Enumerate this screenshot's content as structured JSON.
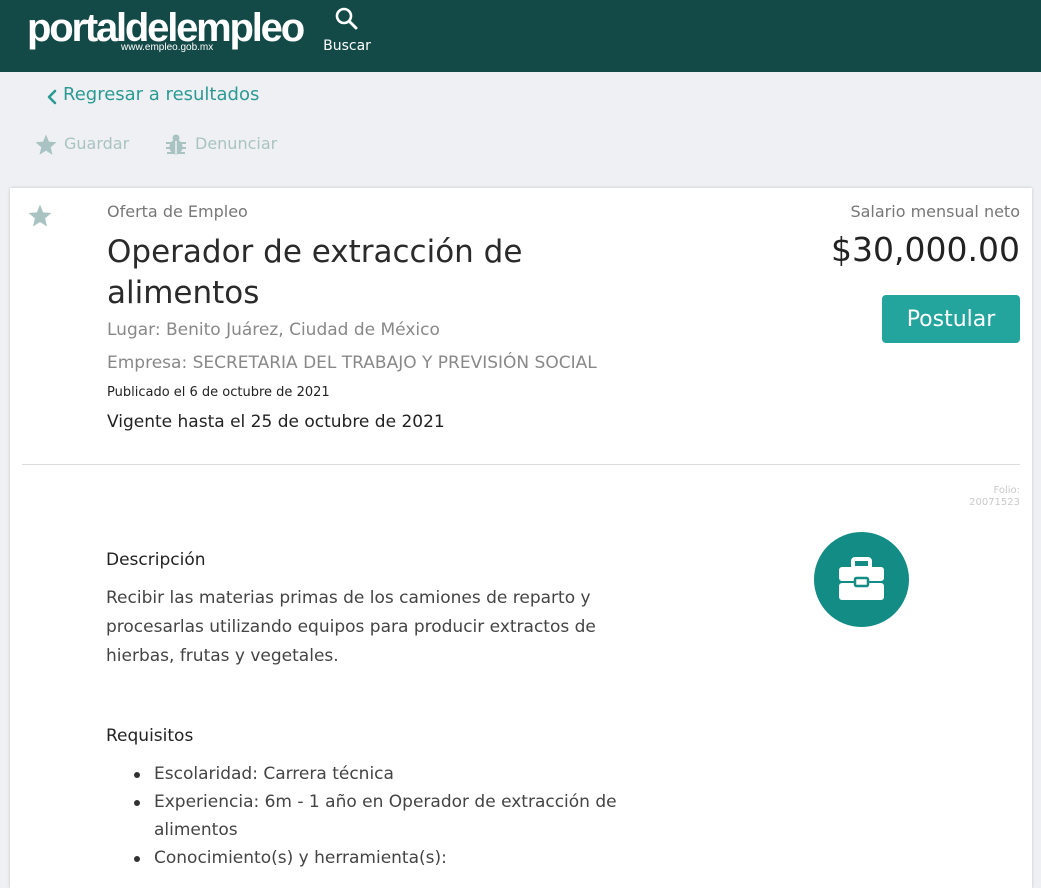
{
  "header": {
    "logo_text": "portaldelempleo",
    "logo_url_text": "www.empleo.gob.mx",
    "search_label": "Buscar",
    "search_icon": "search-icon"
  },
  "nav": {
    "back_label": "Regresar a resultados",
    "save_label": "Guardar",
    "report_label": "Denunciar"
  },
  "job": {
    "eyebrow": "Oferta de Empleo",
    "title": "Operador de extracción de alimentos",
    "place": "Lugar: Benito Juárez, Ciudad de México",
    "company": "Empresa: SECRETARIA DEL TRABAJO Y PREVISIÓN SOCIAL",
    "published": "Publicado el 6 de octubre de 2021",
    "valid_until": "Vigente hasta el 25 de octubre de 2021",
    "salary_label": "Salario mensual neto",
    "salary_value": "$30,000.00",
    "apply_label": "Postular",
    "folio_label": "Folio:",
    "folio_value": "20071523"
  },
  "description": {
    "title": "Descripción",
    "text": "Recibir las materias primas de los camiones de reparto y procesarlas utilizando equipos para producir extractos de hierbas, frutas y vegetales."
  },
  "requirements": {
    "title": "Requisitos",
    "items": [
      "Escolaridad: Carrera técnica",
      "Experiencia: 6m - 1 año en Operador de extracción de alimentos",
      "Conocimiento(s) y herramienta(s):"
    ]
  },
  "colors": {
    "header_bg": "#134a48",
    "accent": "#23a49d",
    "badge": "#128c85",
    "muted_icon": "#a9c3c2"
  }
}
